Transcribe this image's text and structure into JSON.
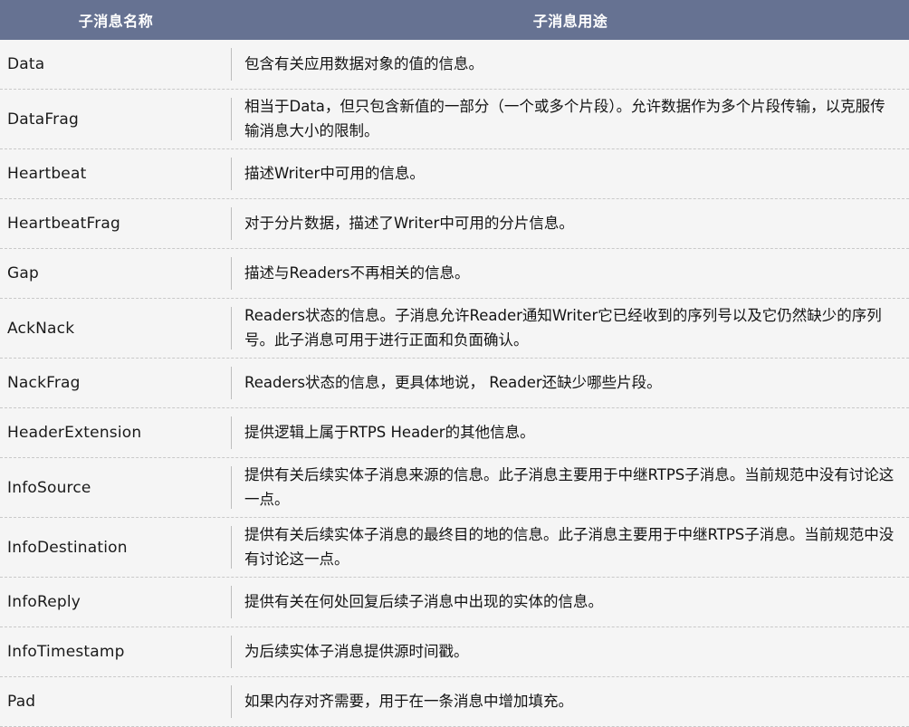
{
  "table": {
    "columns": [
      {
        "key": "name",
        "label": "子消息名称"
      },
      {
        "key": "use",
        "label": "子消息用途"
      }
    ],
    "header_bg": "#667292",
    "header_text_color": "#ffffff",
    "row_bg": "#f5f5f5",
    "divider_color": "#c9c9c9",
    "rows": [
      {
        "name": "Data",
        "use": "包含有关应用数据对象的值的信息。",
        "lines": 1
      },
      {
        "name": "DataFrag",
        "use": "相当于Data，但只包含新值的一部分（一个或多个片段）。允许数据作为多个片段传输，以克服传输消息大小的限制。",
        "lines": 2
      },
      {
        "name": "Heartbeat",
        "use": "描述Writer中可用的信息。",
        "lines": 1
      },
      {
        "name": "HeartbeatFrag",
        "use": "对于分片数据，描述了Writer中可用的分片信息。",
        "lines": 1
      },
      {
        "name": "Gap",
        "use": "描述与Readers不再相关的信息。",
        "lines": 1
      },
      {
        "name": "AckNack",
        "use": "Readers状态的信息。子消息允许Reader通知Writer它已经收到的序列号以及它仍然缺少的序列号。此子消息可用于进行正面和负面确认。",
        "lines": 2
      },
      {
        "name": "NackFrag",
        "use": "Readers状态的信息，更具体地说， Reader还缺少哪些片段。",
        "lines": 1
      },
      {
        "name": "HeaderExtension",
        "use": "提供逻辑上属于RTPS Header的其他信息。",
        "lines": 1
      },
      {
        "name": "InfoSource",
        "use": "提供有关后续实体子消息来源的信息。此子消息主要用于中继RTPS子消息。当前规范中没有讨论这一点。",
        "lines": 2
      },
      {
        "name": "InfoDestination",
        "use": "提供有关后续实体子消息的最终目的地的信息。此子消息主要用于中继RTPS子消息。当前规范中没有讨论这一点。",
        "lines": 2
      },
      {
        "name": "InfoReply",
        "use": "提供有关在何处回复后续子消息中出现的实体的信息。",
        "lines": 1
      },
      {
        "name": "InfoTimestamp",
        "use": "为后续实体子消息提供源时间戳。",
        "lines": 1
      },
      {
        "name": "Pad",
        "use": "如果内存对齐需要，用于在一条消息中增加填充。",
        "lines": 1
      }
    ]
  }
}
